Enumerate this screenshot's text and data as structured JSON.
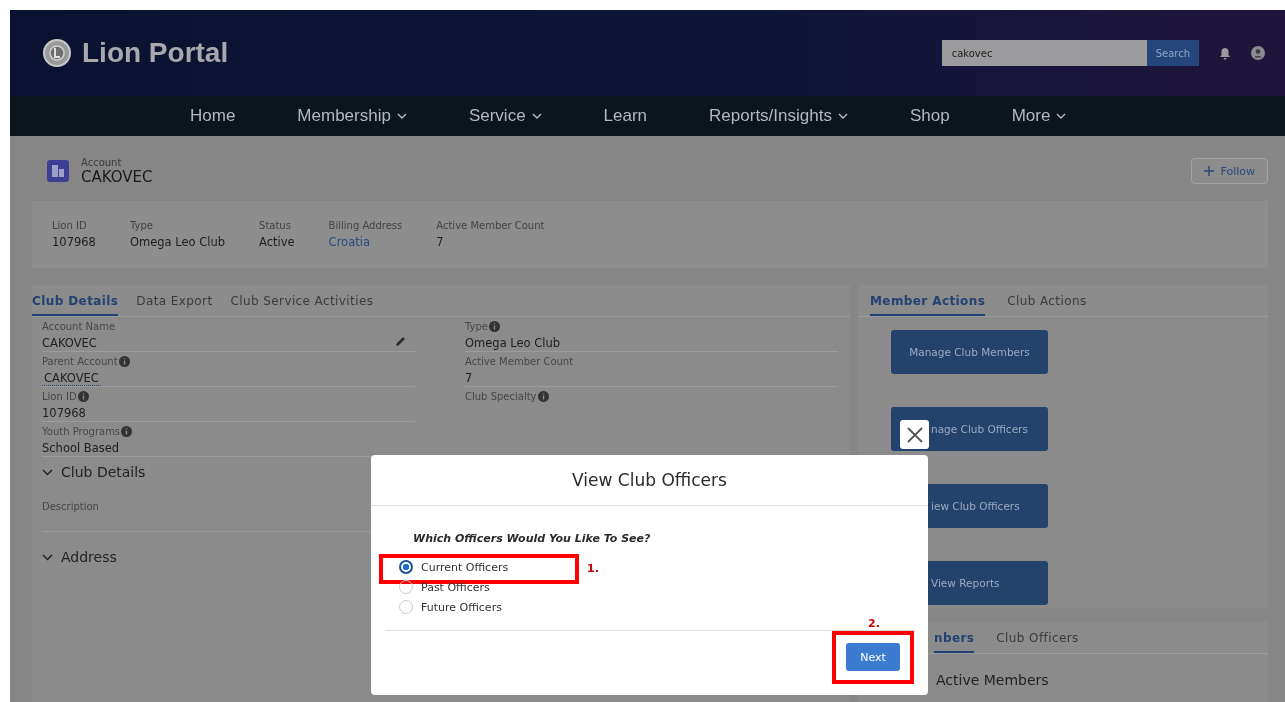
{
  "header": {
    "logo_text": "Lion Portal",
    "search": {
      "value": "cakovec",
      "button": "Search"
    }
  },
  "nav": [
    {
      "label": "Home",
      "dropdown": false
    },
    {
      "label": "Membership",
      "dropdown": true
    },
    {
      "label": "Service",
      "dropdown": true
    },
    {
      "label": "Learn",
      "dropdown": false
    },
    {
      "label": "Reports/Insights",
      "dropdown": true
    },
    {
      "label": "Shop",
      "dropdown": false
    },
    {
      "label": "More",
      "dropdown": true
    }
  ],
  "record": {
    "object_type": "Account",
    "name": "CAKOVEC",
    "follow_button": "Follow"
  },
  "highlights": [
    {
      "label": "Lion ID",
      "value": "107968",
      "kind": "text"
    },
    {
      "label": "Type",
      "value": "Omega Leo Club",
      "kind": "text"
    },
    {
      "label": "Status",
      "value": "Active",
      "kind": "text"
    },
    {
      "label": "Billing Address",
      "value": "Croatia",
      "kind": "link"
    },
    {
      "label": "Active Member Count",
      "value": "7",
      "kind": "text"
    }
  ],
  "detail_tabs": [
    {
      "label": "Club Details",
      "selected": true
    },
    {
      "label": "Data Export",
      "selected": false
    },
    {
      "label": "Club Service Activities",
      "selected": false
    }
  ],
  "fields_left": [
    {
      "label": "Account Name",
      "value": "CAKOVEC",
      "kind": "text",
      "info": false,
      "editable": true
    },
    {
      "label": "Parent Account",
      "value": "CAKOVEC",
      "kind": "link",
      "info": true,
      "editable": false
    },
    {
      "label": "Lion ID",
      "value": "107968",
      "kind": "text",
      "info": true,
      "editable": false
    },
    {
      "label": "Youth Programs",
      "value": "School Based",
      "kind": "text",
      "info": true,
      "editable": false
    }
  ],
  "fields_right": [
    {
      "label": "Type",
      "value": "Omega Leo Club",
      "kind": "text",
      "info": true,
      "editable": false
    },
    {
      "label": "Active Member Count",
      "value": "7",
      "kind": "text",
      "info": false,
      "editable": false
    },
    {
      "label": "Club Specialty",
      "info": true,
      "editable": false
    }
  ],
  "sections": [
    {
      "title": "Club Details",
      "expanded": true,
      "fields": [
        "Description"
      ]
    },
    {
      "title": "Address",
      "expanded": true
    }
  ],
  "action_tabs": [
    {
      "label": "Member Actions",
      "selected": true
    },
    {
      "label": "Club Actions",
      "selected": false
    }
  ],
  "action_buttons": [
    {
      "label": "Manage Club Members",
      "covered": false
    },
    {
      "label": "nage Club Officers",
      "covered": true
    },
    {
      "label": "iew Club Officers",
      "covered": true
    },
    {
      "label": "View Reports",
      "covered": true
    }
  ],
  "related_tabs": [
    {
      "label": "nbers",
      "selected": true
    },
    {
      "label": "Club Officers",
      "selected": false
    }
  ],
  "related_section": {
    "title": "Active Members"
  },
  "modal": {
    "title": "View Club Officers",
    "question": "Which Officers Would You Like To See?",
    "options": [
      {
        "label": "Current Officers",
        "selected": true
      },
      {
        "label": "Past Officers",
        "selected": false
      },
      {
        "label": "Future Officers",
        "selected": false
      }
    ],
    "next_button": "Next",
    "annotations": [
      "1.",
      "2."
    ]
  }
}
